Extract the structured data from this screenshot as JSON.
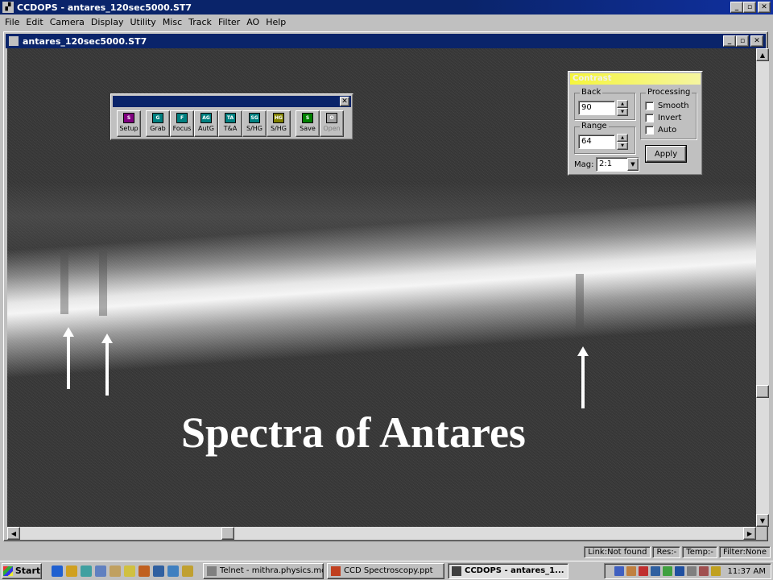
{
  "app": {
    "title": "CCDOPS - antares_120sec5000.ST7",
    "window_buttons": [
      "_",
      "▫",
      "✕"
    ]
  },
  "menu": [
    "File",
    "Edit",
    "Camera",
    "Display",
    "Utility",
    "Misc",
    "Track",
    "Filter",
    "AO",
    "Help"
  ],
  "child_window": {
    "title": "antares_120sec5000.ST7",
    "window_buttons": [
      "_",
      "▫",
      "✕"
    ]
  },
  "image": {
    "caption": "Spectra of Antares",
    "arrows": 3
  },
  "toolbar": {
    "close": "✕",
    "buttons": [
      {
        "label": "Setup",
        "icon": "S",
        "color": "#800080",
        "enabled": true
      },
      {
        "label": "Grab",
        "icon": "G",
        "color": "#008080",
        "enabled": true
      },
      {
        "label": "Focus",
        "icon": "F",
        "color": "#008080",
        "enabled": true
      },
      {
        "label": "AutG",
        "icon": "AG",
        "color": "#008080",
        "enabled": true
      },
      {
        "label": "T&A",
        "icon": "TA",
        "color": "#008080",
        "enabled": true
      },
      {
        "label": "S/HG",
        "icon": "SG",
        "color": "#008080",
        "enabled": true
      },
      {
        "label": "S/HG",
        "icon": "HG",
        "color": "#808000",
        "enabled": true
      },
      {
        "label": "Save",
        "icon": "S",
        "color": "#008000",
        "enabled": true
      },
      {
        "label": "Open",
        "icon": "O",
        "color": "#a0a0a0",
        "enabled": false
      }
    ]
  },
  "contrast": {
    "title": "Contrast",
    "back_label": "Back",
    "back_value": "90",
    "range_label": "Range",
    "range_value": "64",
    "processing_label": "Processing",
    "smooth_label": "Smooth",
    "invert_label": "Invert",
    "auto_label": "Auto",
    "apply_label": "Apply",
    "mag_label": "Mag:",
    "mag_value": "2:1"
  },
  "statusbar": {
    "link": "Link:Not found",
    "res": "Res:-",
    "temp": "Temp:-",
    "filter": "Filter:None"
  },
  "taskbar": {
    "start_label": "Start",
    "quick_launch_icons": [
      "ie-icon",
      "outlook-icon",
      "desktop-icon",
      "notepad-icon",
      "paint-icon",
      "folder-icon",
      "explorer-icon",
      "monitor-icon",
      "help-icon",
      "pencil-icon"
    ],
    "tasks": [
      {
        "label": "Telnet - mithra.physics.mo...",
        "active": false
      },
      {
        "label": "CCD Spectroscopy.ppt",
        "active": false
      },
      {
        "label": "CCDOPS - antares_1...",
        "active": true
      }
    ],
    "clock": "11:37 AM"
  }
}
